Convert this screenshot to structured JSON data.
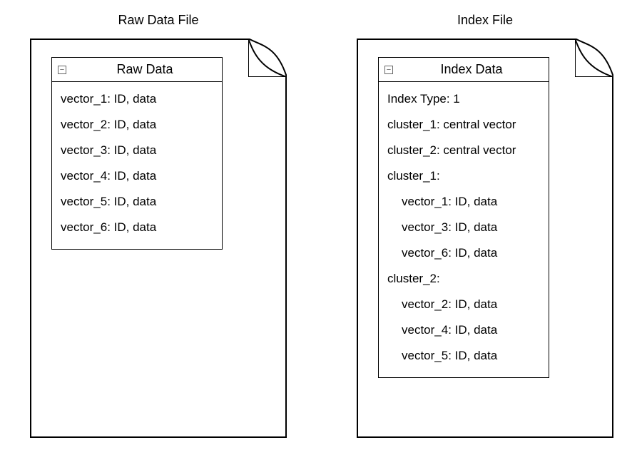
{
  "raw": {
    "title": "Raw Data File",
    "panel_title": "Raw Data",
    "collapse_glyph": "−",
    "items": [
      "vector_1: ID, data",
      "vector_2: ID, data",
      "vector_3: ID, data",
      "vector_4: ID, data",
      "vector_5: ID, data",
      "vector_6: ID, data"
    ]
  },
  "index": {
    "title": "Index File",
    "panel_title": "Index Data",
    "collapse_glyph": "−",
    "items": [
      {
        "text": "Index Type: 1",
        "indent": false
      },
      {
        "text": "cluster_1: central vector",
        "indent": false
      },
      {
        "text": "cluster_2: central vector",
        "indent": false
      },
      {
        "text": "cluster_1:",
        "indent": false
      },
      {
        "text": "vector_1: ID, data",
        "indent": true
      },
      {
        "text": "vector_3: ID, data",
        "indent": true
      },
      {
        "text": "vector_6: ID, data",
        "indent": true
      },
      {
        "text": "cluster_2:",
        "indent": false
      },
      {
        "text": "vector_2: ID, data",
        "indent": true
      },
      {
        "text": "vector_4: ID, data",
        "indent": true
      },
      {
        "text": "vector_5: ID, data",
        "indent": true
      }
    ]
  }
}
